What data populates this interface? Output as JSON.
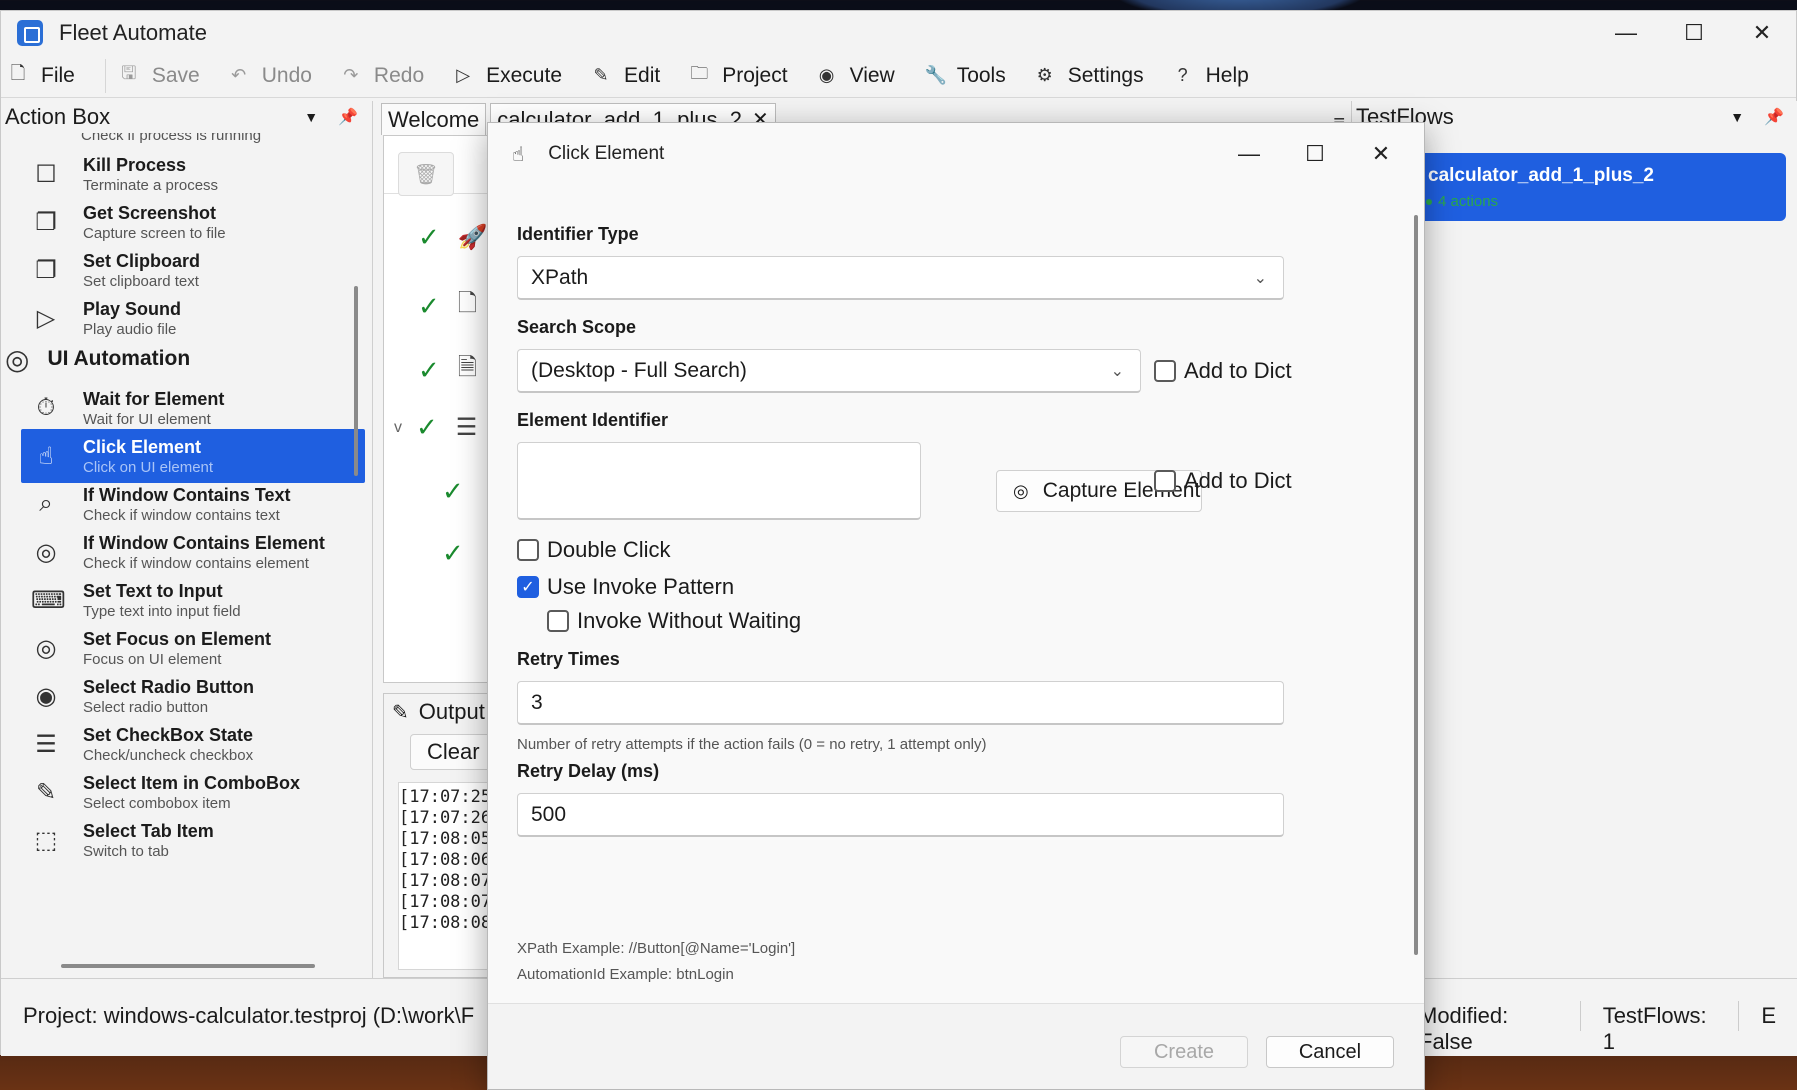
{
  "window": {
    "title": "Fleet Automate",
    "minimize": "—",
    "maximize": "☐",
    "close": "✕"
  },
  "menu": [
    {
      "label": "File",
      "icon": "file-icon",
      "glyph": "🗋",
      "disabled": false
    },
    {
      "label": "Save",
      "icon": "save-icon",
      "glyph": "🖫",
      "disabled": true
    },
    {
      "label": "Undo",
      "icon": "undo-icon",
      "glyph": "↶",
      "disabled": true
    },
    {
      "label": "Redo",
      "icon": "redo-icon",
      "glyph": "↷",
      "disabled": true
    },
    {
      "label": "Execute",
      "icon": "play-icon",
      "glyph": "▷",
      "disabled": false
    },
    {
      "label": "Edit",
      "icon": "edit-icon",
      "glyph": "✎",
      "disabled": false
    },
    {
      "label": "Project",
      "icon": "folder-icon",
      "glyph": "🗀",
      "disabled": false
    },
    {
      "label": "View",
      "icon": "eye-icon",
      "glyph": "◉",
      "disabled": false
    },
    {
      "label": "Tools",
      "icon": "wrench-icon",
      "glyph": "🔧",
      "disabled": false
    },
    {
      "label": "Settings",
      "icon": "gear-icon",
      "glyph": "⚙",
      "disabled": false
    },
    {
      "label": "Help",
      "icon": "help-icon",
      "glyph": "?",
      "disabled": false
    }
  ],
  "action_box": {
    "title": "Action Box",
    "cut_sub": "Check if process is running",
    "items_a": [
      {
        "title": "Kill Process",
        "sub": "Terminate a process",
        "icon": "square-icon",
        "glyph": "☐"
      },
      {
        "title": "Get Screenshot",
        "sub": "Capture screen to file",
        "icon": "copy-icon",
        "glyph": "❐"
      },
      {
        "title": "Set Clipboard",
        "sub": "Set clipboard text",
        "icon": "clipboard-icon",
        "glyph": "❐"
      },
      {
        "title": "Play Sound",
        "sub": "Play audio file",
        "icon": "play-icon",
        "glyph": "▷"
      }
    ],
    "category": "UI Automation",
    "items_b": [
      {
        "title": "Wait for Element",
        "sub": "Wait for UI element",
        "icon": "timer-icon",
        "glyph": "⏱"
      },
      {
        "title": "Click Element",
        "sub": "Click on UI element",
        "icon": "click-icon",
        "glyph": "☝"
      },
      {
        "title": "If Window Contains Text",
        "sub": "Check if window contains text",
        "icon": "search-icon",
        "glyph": "⌕"
      },
      {
        "title": "If Window Contains Element",
        "sub": "Check if window contains element",
        "icon": "target-icon",
        "glyph": "◎"
      },
      {
        "title": "Set Text to Input",
        "sub": "Type text into input field",
        "icon": "keyboard-icon",
        "glyph": "⌨"
      },
      {
        "title": "Set Focus on Element",
        "sub": "Focus on UI element",
        "icon": "target-icon",
        "glyph": "◎"
      },
      {
        "title": "Select Radio Button",
        "sub": "Select radio button",
        "icon": "radio-icon",
        "glyph": "◉"
      },
      {
        "title": "Set CheckBox State",
        "sub": "Check/uncheck checkbox",
        "icon": "filter-icon",
        "glyph": "☰"
      },
      {
        "title": "Select Item in ComboBox",
        "sub": "Select combobox item",
        "icon": "edit-icon",
        "glyph": "✎"
      },
      {
        "title": "Select Tab Item",
        "sub": "Switch to tab",
        "icon": "tab-icon",
        "glyph": "⬚"
      }
    ]
  },
  "tabs": {
    "welcome": "Welcome",
    "active": "calculator_add_1_plus_2",
    "close": "✕"
  },
  "output": {
    "title": "Output",
    "clear": "Clear",
    "log": [
      "[17:07:25",
      "[17:07:26",
      "[17:08:05",
      "[17:08:06",
      "[17:08:07",
      "[17:08:07",
      "[17:08:08"
    ]
  },
  "testflows": {
    "title": "TestFlows",
    "items": [
      {
        "name": "calculator_add_1_plus_2",
        "sub": "4 actions"
      }
    ]
  },
  "status": {
    "project": "Project: windows-calculator.testproj (D:\\work\\F",
    "modified": "Modified: False",
    "testflows": "TestFlows: 1",
    "extra": "E"
  },
  "dialog": {
    "title": "Click Element",
    "identifier_type_label": "Identifier Type",
    "identifier_type_value": "XPath",
    "search_scope_label": "Search Scope",
    "search_scope_value": "(Desktop - Full Search)",
    "add_to_dict": "Add to Dict",
    "element_identifier_label": "Element Identifier",
    "element_identifier_value": "",
    "capture_button": "Capture Element",
    "double_click": "Double Click",
    "use_invoke_pattern": "Use Invoke Pattern",
    "invoke_without_waiting": "Invoke Without Waiting",
    "retry_times_label": "Retry Times",
    "retry_times_value": "3",
    "retry_times_hint": "Number of retry attempts if the action fails (0 = no retry, 1 attempt only)",
    "retry_delay_label": "Retry Delay (ms)",
    "retry_delay_value": "500",
    "xpath_example": "XPath Example: //Button[@Name='Login']",
    "automationid_example": "AutomationId Example: btnLogin",
    "create": "Create",
    "cancel": "Cancel",
    "checked": {
      "double_click": false,
      "use_invoke_pattern": true,
      "invoke_without_waiting": false,
      "add_to_dict_scope": false,
      "add_to_dict_identifier": false
    }
  },
  "colors": {
    "accent": "#1f5fe0",
    "check_green": "#1a8a2e"
  }
}
